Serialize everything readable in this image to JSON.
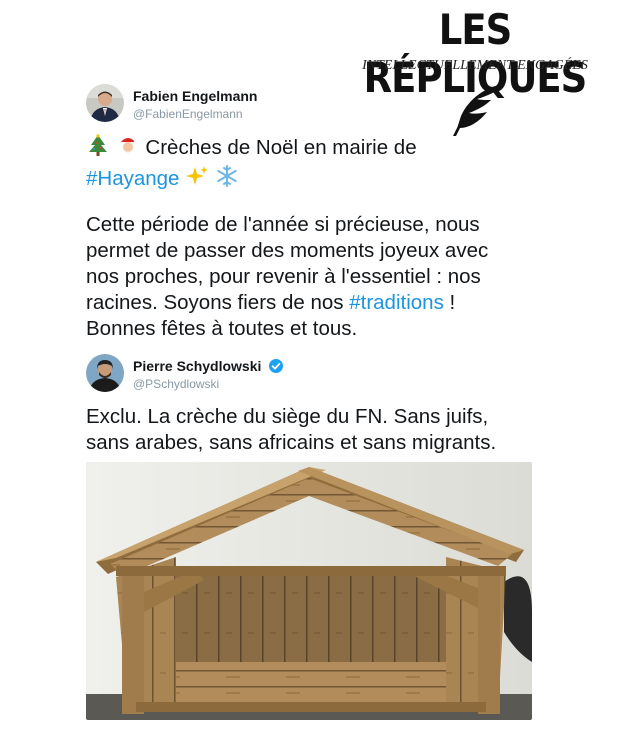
{
  "header": {
    "title": "LES RÉPLIQUES",
    "subtitle": "INTELLECTUELLEMENT ENGAGÉES"
  },
  "tweet1": {
    "author_name": "Fabien Engelmann",
    "author_handle": "@FabienEngelmann",
    "line1_text": "Crèches de Noël en mairie de",
    "hashtag_hayange": "#Hayange",
    "para_part1": "Cette période de l'année si précieuse, nous permet de passer des moments joyeux avec nos proches, pour revenir à l'essentiel : nos racines. Soyons fiers de nos",
    "hashtag_traditions": "#traditions",
    "para_part2": "!",
    "para_line5": "Bonnes fêtes à toutes et tous."
  },
  "tweet2": {
    "author_name": "Pierre Schydlowski",
    "author_handle": "@PSchydlowski",
    "verified": true,
    "text": "Exclu. La crèche du siège du FN. Sans juifs, sans arabes, sans africains et sans migrants."
  },
  "colors": {
    "link": "#1b95e0",
    "verified": "#1da1f2",
    "wood": "#b98f5a"
  },
  "icons": [
    "quill-icon",
    "christmas-tree-icon",
    "santa-icon",
    "sparkles-icon",
    "snowflake-icon",
    "verified-badge-icon"
  ]
}
